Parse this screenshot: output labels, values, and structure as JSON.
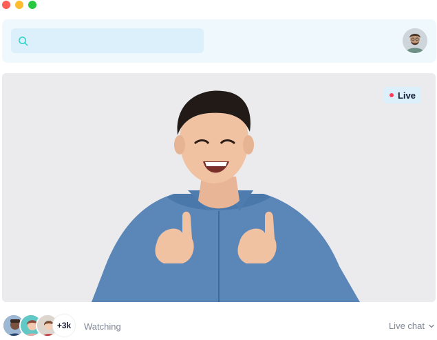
{
  "window": {
    "controls": [
      "close",
      "minimize",
      "maximize"
    ]
  },
  "search": {
    "placeholder": "",
    "value": ""
  },
  "stream": {
    "live_label": "Live"
  },
  "viewers": {
    "extra_count": "+3k",
    "label": "Watching"
  },
  "chat": {
    "toggle_label": "Live chat"
  },
  "colors": {
    "accent": "#28d1c4",
    "live": "#ff3b5c",
    "panel": "#eef8fd"
  }
}
